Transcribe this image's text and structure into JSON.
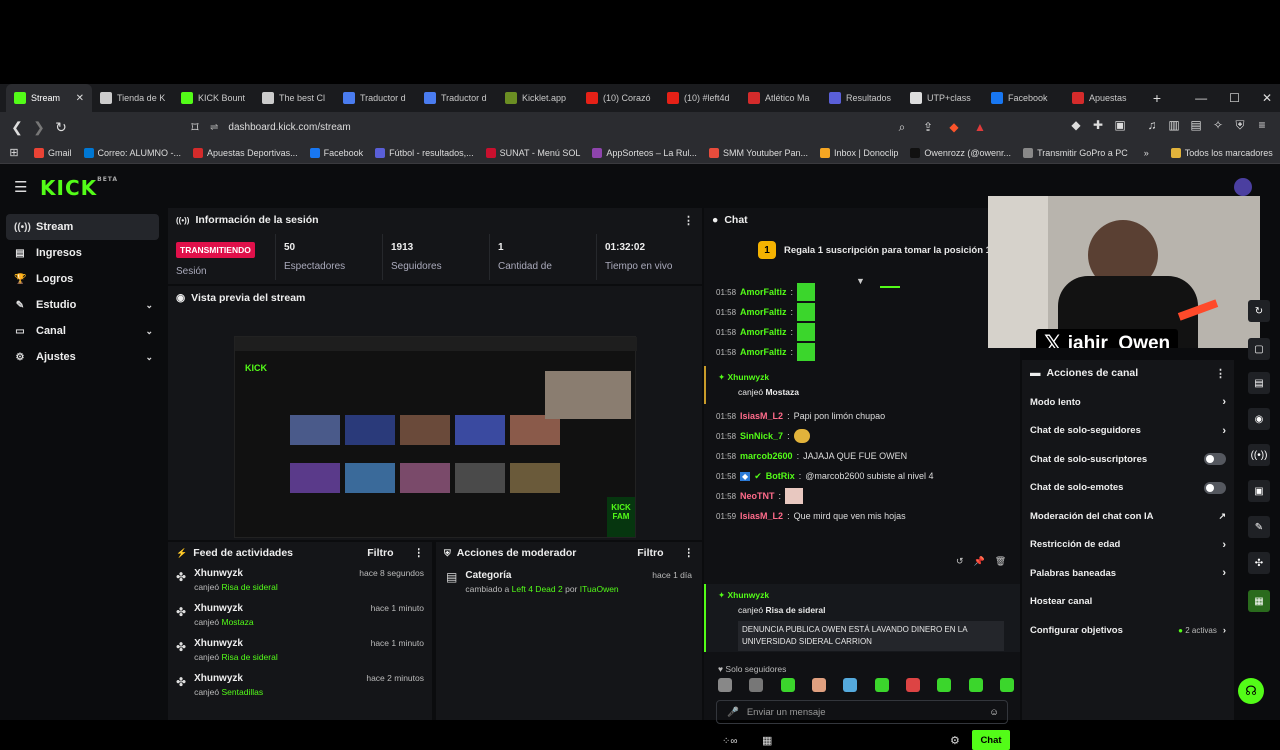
{
  "browser": {
    "tabs": [
      {
        "label": "Stream",
        "color": "#53fc18",
        "active": true
      },
      {
        "label": "Tienda de K",
        "color": "#cccccc"
      },
      {
        "label": "KICK Bount",
        "color": "#53fc18"
      },
      {
        "label": "The best Cl",
        "color": "#cccccc"
      },
      {
        "label": "Traductor d",
        "color": "#4a7cf0"
      },
      {
        "label": "Traductor d",
        "color": "#4a7cf0"
      },
      {
        "label": "Kicklet.app",
        "color": "#6b8e23"
      },
      {
        "label": "(10) Corazó",
        "color": "#e62117"
      },
      {
        "label": "(10) #left4d",
        "color": "#e62117"
      },
      {
        "label": "Atlético Ma",
        "color": "#d42b2b"
      },
      {
        "label": "Resultados",
        "color": "#5a5fd8"
      },
      {
        "label": "UTP+class",
        "color": "#dddddd"
      },
      {
        "label": "Facebook",
        "color": "#1877f2"
      },
      {
        "label": "Apuestas",
        "color": "#d42b2b"
      }
    ],
    "new_tab": "+",
    "win_min": "—",
    "win_max": "☐",
    "win_close": "✕",
    "tab_close": "✕",
    "url": "dashboard.kick.com/stream",
    "bookmarks": [
      {
        "label": "Gmail",
        "color": "#ea4335"
      },
      {
        "label": "Correo: ALUMNO -...",
        "color": "#0078d4"
      },
      {
        "label": "Apuestas Deportivas...",
        "color": "#d42b2b"
      },
      {
        "label": "Facebook",
        "color": "#1877f2"
      },
      {
        "label": "Fútbol - resultados,...",
        "color": "#5a5fd8"
      },
      {
        "label": "SUNAT - Menú SOL",
        "color": "#c8102e"
      },
      {
        "label": "AppSorteos – La Rul...",
        "color": "#8e44ad"
      },
      {
        "label": "SMM Youtuber Pan...",
        "color": "#e74c3c"
      },
      {
        "label": "Inbox | Donoclip",
        "color": "#f5a623"
      },
      {
        "label": "Owenrozz (@owenr...",
        "color": "#111111"
      },
      {
        "label": "Transmitir GoPro a PC",
        "color": "#888888"
      }
    ],
    "bookmarks_more": "»",
    "all_bookmarks": "Todos los marcadores"
  },
  "sidebar": {
    "items": [
      {
        "label": "Stream",
        "icon": "((•))",
        "active": true
      },
      {
        "label": "Ingresos",
        "icon": "▤"
      },
      {
        "label": "Logros",
        "icon": "🏆"
      },
      {
        "label": "Estudio",
        "icon": "✎",
        "chevron": true
      },
      {
        "label": "Canal",
        "icon": "▭",
        "chevron": true
      },
      {
        "label": "Ajustes",
        "icon": "⚙",
        "chevron": true
      }
    ]
  },
  "session": {
    "title": "Información de la sesión",
    "live_badge": "TRANSMITIENDO",
    "session_label": "Sesión",
    "stats": [
      {
        "value": "50",
        "label": "Espectadores"
      },
      {
        "value": "1913",
        "label": "Seguidores"
      },
      {
        "value": "1",
        "label": "Cantidad de"
      },
      {
        "value": "01:32:02",
        "label": "Tiempo en vivo"
      }
    ]
  },
  "preview": {
    "title": "Vista previa del stream"
  },
  "feed": {
    "title": "Feed de actividades",
    "filter": "Filtro",
    "items": [
      {
        "user": "Xhunwyzk",
        "action": "canjeó",
        "reward": "Risa de sideral",
        "time": "hace 8 segundos"
      },
      {
        "user": "Xhunwyzk",
        "action": "canjeó",
        "reward": "Mostaza",
        "time": "hace 1 minuto"
      },
      {
        "user": "Xhunwyzk",
        "action": "canjeó",
        "reward": "Risa de sideral",
        "time": "hace 1 minuto"
      },
      {
        "user": "Xhunwyzk",
        "action": "canjeó",
        "reward": "Sentadillas",
        "time": "hace 2 minutos"
      }
    ]
  },
  "modactions": {
    "title": "Acciones de moderador",
    "filter": "Filtro",
    "items": [
      {
        "title": "Categoría",
        "prefix": "cambiado a",
        "category": "Left 4 Dead 2",
        "by": "por",
        "user": "ITuaOwen",
        "time": "hace 1 día"
      }
    ]
  },
  "chat": {
    "title": "Chat",
    "sub_banner": "Regala 1 suscripción para tomar la posición 1",
    "sub_count": "1",
    "lines": [
      {
        "time": "01:58",
        "user": "AmorFaltiz",
        "color": "#53fc18",
        "text": "",
        "emote": true
      },
      {
        "time": "01:58",
        "user": "AmorFaltiz",
        "color": "#53fc18",
        "text": "",
        "emote": true
      },
      {
        "time": "01:58",
        "user": "AmorFaltiz",
        "color": "#53fc18",
        "text": "",
        "emote": true
      },
      {
        "time": "01:58",
        "user": "AmorFaltiz",
        "color": "#53fc18",
        "text": "",
        "emote": true
      }
    ],
    "redeem1": {
      "user": "Xhunwyzk",
      "action": "canjeó",
      "reward": "Mostaza"
    },
    "lines2": [
      {
        "time": "01:58",
        "user": "IsiasM_L2",
        "color": "#ff6b8a",
        "text": "Papi pon limón chupao"
      },
      {
        "time": "01:58",
        "user": "SinNick_7",
        "color": "#53fc18",
        "text": ""
      },
      {
        "time": "01:58",
        "user": "marcob2600",
        "color": "#53fc18",
        "text": "JAJAJA QUE FUE OWEN"
      },
      {
        "time": "01:58",
        "user": "BotRix",
        "color": "#53fc18",
        "text": "@marcob2600 subiste al nivel 4"
      },
      {
        "time": "01:58",
        "user": "NeoTNT",
        "color": "#ff6b8a",
        "text": ""
      },
      {
        "time": "01:59",
        "user": "IsiasM_L2",
        "color": "#ff6b8a",
        "text": "Que mird que ven mis hojas"
      }
    ],
    "redeem2": {
      "user": "Xhunwyzk",
      "action": "canjeó",
      "reward": "Risa de sideral",
      "message": "DENUNCIA PUBLICA OWEN ESTÁ LAVANDO DINERO EN LA UNIVERSIDAD SIDERAL CARRION"
    },
    "followers_only": "Solo seguidores",
    "input_placeholder": "Enviar un mensaje",
    "send": "Chat"
  },
  "channel_actions": {
    "title": "Acciones de canal",
    "items": [
      {
        "label": "Modo lento",
        "kind": "arrow"
      },
      {
        "label": "Chat de solo-seguidores",
        "kind": "arrow"
      },
      {
        "label": "Chat de solo-suscriptores",
        "kind": "toggle"
      },
      {
        "label": "Chat de solo-emotes",
        "kind": "toggle"
      },
      {
        "label": "Moderación del chat con IA",
        "kind": "ext"
      },
      {
        "label": "Restricción de edad",
        "kind": "arrow"
      },
      {
        "label": "Palabras baneadas",
        "kind": "arrow"
      },
      {
        "label": "Hostear canal",
        "kind": "none"
      },
      {
        "label": "Configurar objetivos",
        "kind": "arrow",
        "badge": "2 activas"
      }
    ]
  },
  "webcam": {
    "handle": "jahir_Owen"
  },
  "colors": {
    "brand": "#53fc18",
    "live": "#e0104a"
  }
}
